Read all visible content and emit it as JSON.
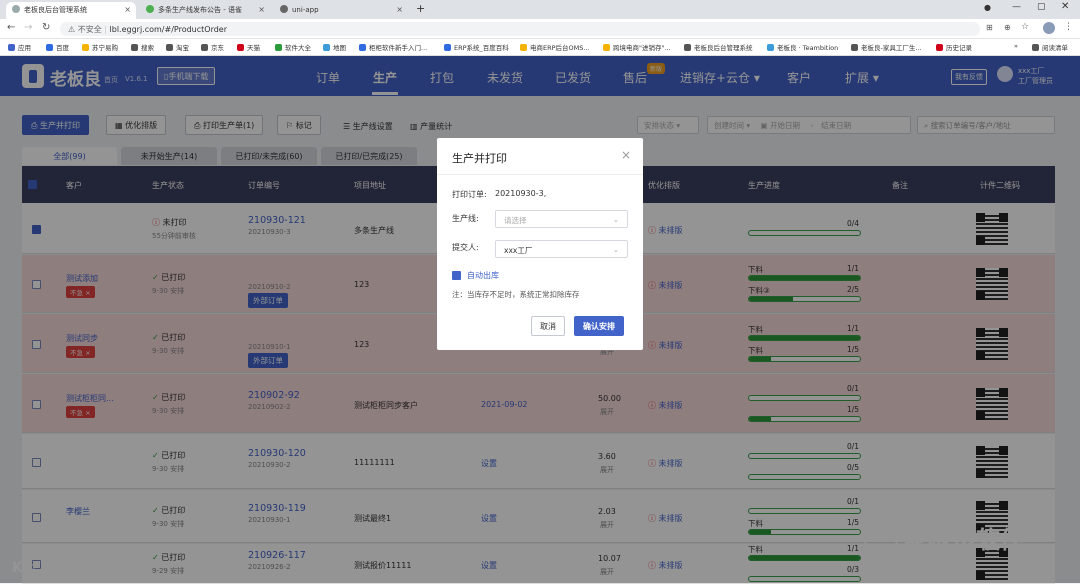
{
  "browser": {
    "tabs": [
      {
        "title": "老板良后台管理系统",
        "active": true
      },
      {
        "title": "多条生产线发布公告 - 语雀",
        "active": false
      },
      {
        "title": "uni-app",
        "active": false
      }
    ],
    "new_tab": "+",
    "insecure_label": "不安全",
    "url": "lbl.eggrj.com/#/ProductOrder",
    "bookmarks": [
      "应用",
      "百度",
      "苏宁易购",
      "搜索",
      "淘宝",
      "京东",
      "天猫",
      "软件大全",
      "地图",
      "柜柜软件新手入门...",
      "ERP系统_百度百科",
      "电商ERP后台OMS...",
      "跨境电商\"进销存\"...",
      "老板良后台管理系统",
      "老板良 · Teambition",
      "老板良-家具工厂生...",
      "历史记录"
    ],
    "reading_list": "阅读清单"
  },
  "app": {
    "logo": "老板良",
    "home": "首页",
    "version": "V1.6.1",
    "download_btn": "手机端下载",
    "nav": [
      "订单",
      "生产",
      "打包",
      "未发货",
      "已发货",
      "售后",
      "进销存+云仓",
      "客户",
      "扩展"
    ],
    "nav_badge": "新版",
    "feedback": "我有反馈",
    "user_line1": "xxx工厂",
    "user_line2": "工厂管理员"
  },
  "toolbar": {
    "produce_print": "生产并打印",
    "optimize": "优化排版",
    "print_sheet": "打印生产单(1)",
    "mark": "标记",
    "line_settings": "生产线设置",
    "output_stats": "产量统计",
    "install_status": "安排状态",
    "create_time": "创建时间",
    "start_date": "开始日期",
    "date_sep": "-",
    "end_date": "结束日期",
    "search_placeholder": "搜索订单编号/客户/地址"
  },
  "status_tabs": [
    "全部(99)",
    "未开始生产(14)",
    "已打印/未完成(60)",
    "已打印/已完成(25)"
  ],
  "table": {
    "headers": [
      "客户",
      "生产状态",
      "订单编号",
      "项目地址",
      "优化排版",
      "生产进度",
      "备注",
      "计件二维码"
    ],
    "rows": [
      {
        "customer": "",
        "status": "未打印",
        "status_sub": "55分钟前审核",
        "order": "210930-121",
        "order_sub": "20210930-3",
        "address": "多条生产线",
        "date": "",
        "price": "",
        "price_sub": "",
        "layout": "未排版",
        "checked": true,
        "pink": false,
        "urgent": false,
        "outer": false,
        "progress": [
          {
            "label": "",
            "val": "0/4",
            "pct": 0
          }
        ]
      },
      {
        "customer": "测试添加",
        "status": "已打印",
        "status_sub": "9-30 安排",
        "order": "",
        "order_sub": "20210910-2",
        "address": "123",
        "date": "",
        "price": "",
        "price_sub": "",
        "layout": "未排版",
        "checked": false,
        "pink": true,
        "urgent": true,
        "outer": true,
        "progress": [
          {
            "label": "下料",
            "val": "1/1",
            "pct": 100
          },
          {
            "label": "下料③",
            "val": "2/5",
            "pct": 40
          }
        ]
      },
      {
        "customer": "测试同步",
        "status": "已打印",
        "status_sub": "9-30 安排",
        "order": "",
        "order_sub": "20210910-1",
        "address": "123",
        "date": "",
        "price": "",
        "price_sub": "展开",
        "layout": "未排版",
        "checked": false,
        "pink": true,
        "urgent": true,
        "outer": true,
        "progress": [
          {
            "label": "下料",
            "val": "1/1",
            "pct": 100
          },
          {
            "label": "下料",
            "val": "1/5",
            "pct": 20
          }
        ]
      },
      {
        "customer": "测试柜柜同...",
        "status": "已打印",
        "status_sub": "9-30 安排",
        "order": "210902-92",
        "order_sub": "20210902-2",
        "address": "测试柜柜同步客户",
        "date": "2021-09-02",
        "price": "50.00",
        "price_sub": "展开",
        "layout": "未排版",
        "checked": false,
        "pink": true,
        "urgent": true,
        "outer": false,
        "progress": [
          {
            "label": "",
            "val": "0/1",
            "pct": 0
          },
          {
            "label": "",
            "val": "1/5",
            "pct": 20
          }
        ]
      },
      {
        "customer": "",
        "status": "已打印",
        "status_sub": "9-30 安排",
        "order": "210930-120",
        "order_sub": "20210930-2",
        "address": "11111111",
        "date": "设置",
        "price": "3.60",
        "price_sub": "展开",
        "layout": "未排版",
        "checked": false,
        "pink": false,
        "urgent": false,
        "outer": false,
        "progress": [
          {
            "label": "",
            "val": "0/1",
            "pct": 0
          },
          {
            "label": "",
            "val": "0/5",
            "pct": 0
          }
        ]
      },
      {
        "customer": "李樱兰",
        "status": "已打印",
        "status_sub": "9-30 安排",
        "order": "210930-119",
        "order_sub": "20210930-1",
        "address": "测试最终1",
        "date": "设置",
        "price": "2.03",
        "price_sub": "展开",
        "layout": "未排版",
        "checked": false,
        "pink": false,
        "urgent": false,
        "outer": false,
        "progress": [
          {
            "label": "",
            "val": "0/1",
            "pct": 0
          },
          {
            "label": "下料",
            "val": "1/5",
            "pct": 20
          }
        ]
      },
      {
        "customer": "",
        "status": "已打印",
        "status_sub": "9-29 安排",
        "order": "210926-117",
        "order_sub": "20210926-2",
        "address": "测试报价11111",
        "date": "设置",
        "price": "10.07",
        "price_sub": "展开",
        "layout": "未排版",
        "checked": false,
        "pink": false,
        "urgent": false,
        "outer": false,
        "progress": [
          {
            "label": "下料",
            "val": "1/1",
            "pct": 100
          },
          {
            "label": "",
            "val": "0/3",
            "pct": 0
          }
        ]
      }
    ],
    "urgent_label": "不急",
    "outer_label": "外部订单"
  },
  "modal": {
    "title": "生产并打印",
    "print_order_label": "打印订单:",
    "print_order_value": "20210930-3,",
    "line_label": "生产线:",
    "line_placeholder": "请选择",
    "submitter_label": "提交人:",
    "submitter_value": "xxx工厂",
    "auto_out": "自动出库",
    "note": "注：当库存不足时，系统正常扣除库存",
    "cancel": "取消",
    "confirm": "确认安排"
  },
  "watermarks": {
    "left": "大数跨境",
    "right": "老板良软件"
  },
  "colors": {
    "accent": "#4263c9",
    "header_dark": "#3b4060",
    "pink_row": "#f6d9d9",
    "progress_green": "#2b9a3a",
    "danger": "#e04040"
  }
}
